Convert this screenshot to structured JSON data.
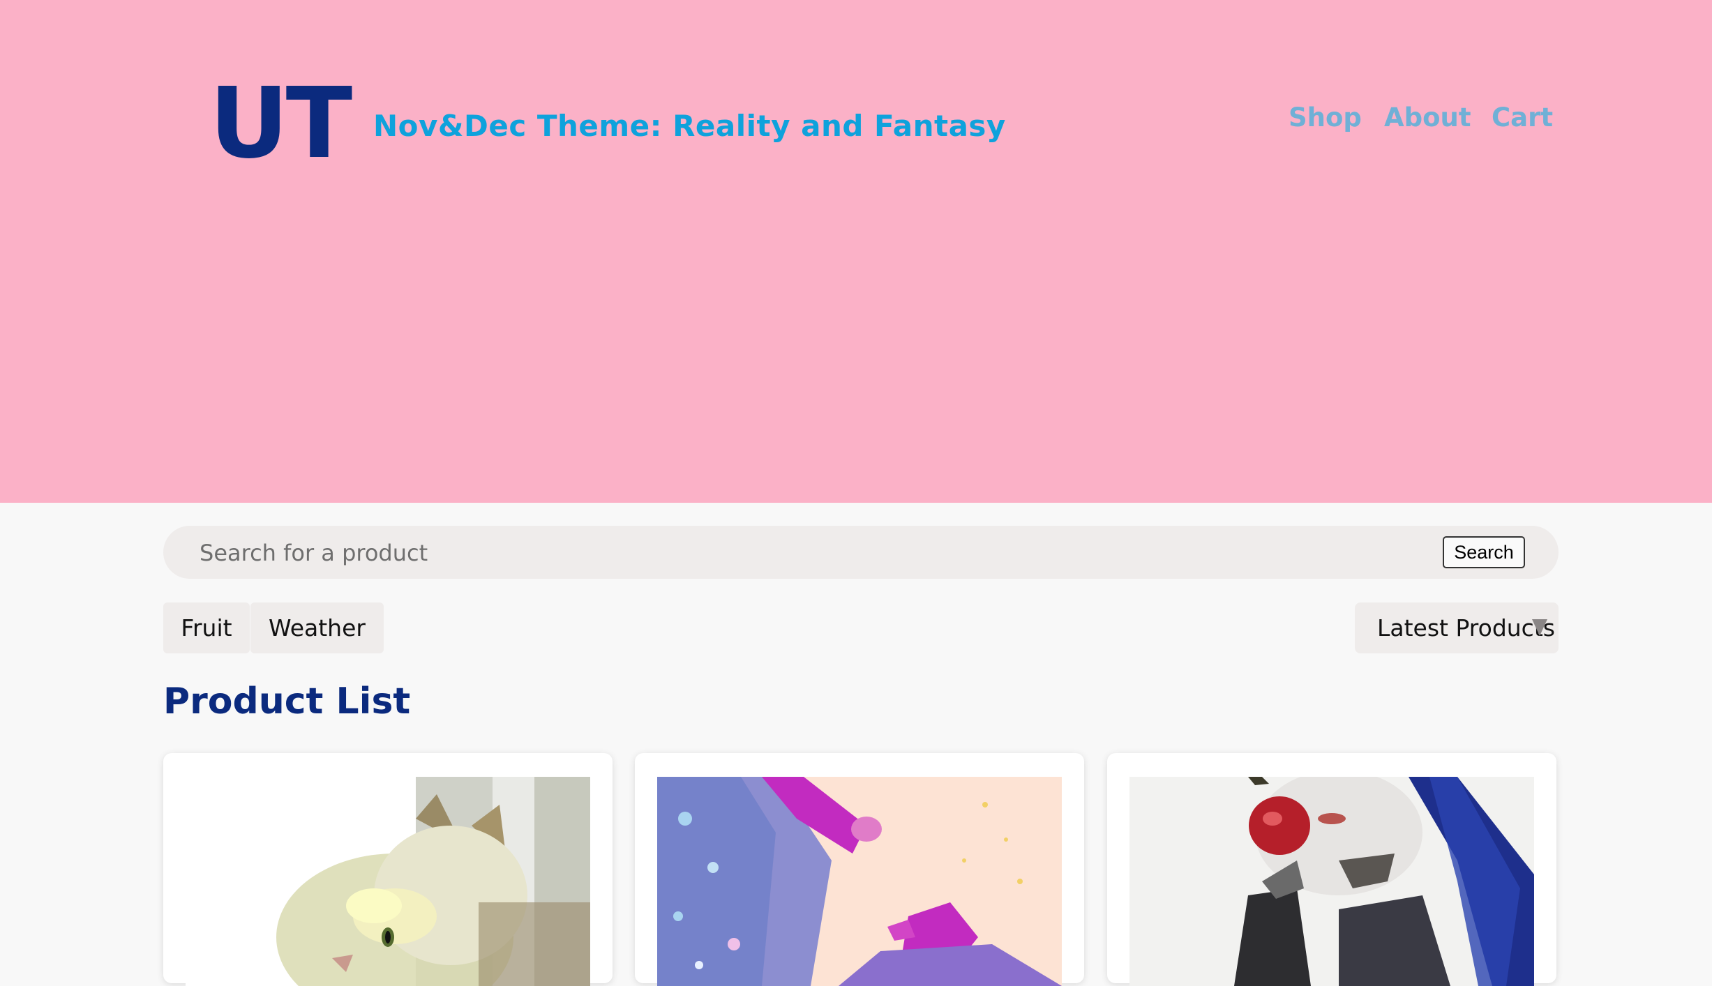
{
  "header": {
    "logo": "UT",
    "theme_title": "Nov&Dec Theme: Reality and Fantasy",
    "nav": [
      {
        "label": "Shop"
      },
      {
        "label": "About"
      },
      {
        "label": "Cart"
      }
    ]
  },
  "search": {
    "placeholder": "Search for a product",
    "button_label": "Search"
  },
  "filters": {
    "categories": [
      "Fruit",
      "Weather"
    ],
    "sort_selected": "Latest Products"
  },
  "product_list": {
    "title": "Product List",
    "products": [
      {
        "image_icon": "cat-illustration"
      },
      {
        "image_icon": "pink-figure-illustration"
      },
      {
        "image_icon": "woman-apple-illustration"
      }
    ]
  },
  "colors": {
    "hero_background": "#fbb1c7",
    "logo": "#0b2a7e",
    "theme_title": "#0ea2dc",
    "nav_link": "#6fb0d6",
    "page_background": "#f8f8f8"
  }
}
